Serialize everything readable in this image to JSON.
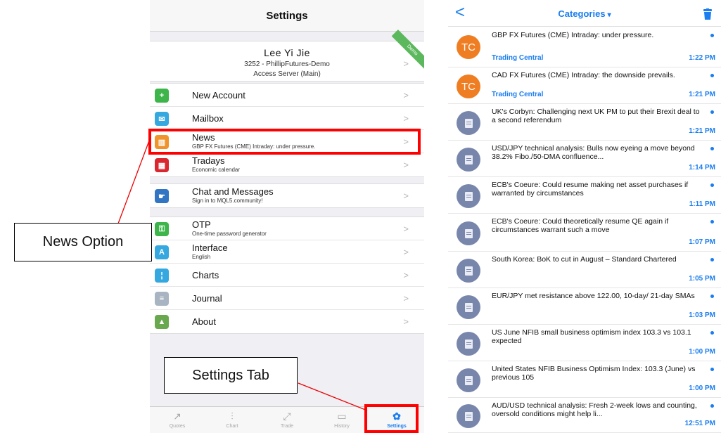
{
  "settings": {
    "header_title": "Settings",
    "account": {
      "name": "Lee Yi Jie",
      "line1": "3252 - PhillipFutures-Demo",
      "line2": "Access Server (Main)",
      "ribbon": "Demo"
    },
    "group1": [
      {
        "title": "New Account",
        "sub": "",
        "icon": "person-add-icon",
        "color": "#3db54a"
      },
      {
        "title": "Mailbox",
        "sub": "",
        "icon": "envelope-icon",
        "color": "#35a8e0"
      },
      {
        "title": "News",
        "sub": "GBP FX Futures (CME) Intraday: under pressure.",
        "icon": "book-icon",
        "color": "#f0932b"
      },
      {
        "title": "Tradays",
        "sub": "Economic calendar",
        "icon": "calendar-icon",
        "color": "#d9262f"
      }
    ],
    "group2": [
      {
        "title": "Chat and Messages",
        "sub": "Sign in to MQL5.community!",
        "icon": "chat-icon",
        "color": "#3275c2"
      }
    ],
    "group3": [
      {
        "title": "OTP",
        "sub": "One-time password generator",
        "icon": "key-icon",
        "color": "#3db54a"
      },
      {
        "title": "Interface",
        "sub": "English",
        "icon": "translate-icon",
        "color": "#35a8e0"
      },
      {
        "title": "Charts",
        "sub": "",
        "icon": "candles-icon",
        "color": "#35a8e0"
      },
      {
        "title": "Journal",
        "sub": "",
        "icon": "journal-icon",
        "color": "#a9b4c2"
      },
      {
        "title": "About",
        "sub": "",
        "icon": "about-icon",
        "color": "#6aa84f"
      }
    ],
    "tabs": [
      {
        "label": "Quotes",
        "icon": "quotes-icon",
        "glyph": "↗"
      },
      {
        "label": "Chart",
        "icon": "chart-icon",
        "glyph": "⫶"
      },
      {
        "label": "Trade",
        "icon": "trade-icon",
        "glyph": "⤢"
      },
      {
        "label": "History",
        "icon": "history-icon",
        "glyph": "▭"
      },
      {
        "label": "Settings",
        "icon": "gear-icon",
        "glyph": "✿"
      }
    ],
    "active_tab": "Settings"
  },
  "callouts": {
    "news_option": "News Option",
    "settings_tab": "Settings Tab"
  },
  "news": {
    "title": "Categories",
    "caret": "▾",
    "back": "<",
    "items": [
      {
        "headline": "GBP FX Futures (CME) Intraday: under pressure.",
        "source": "Trading Central",
        "time": "1:22 PM",
        "avatar": "TC"
      },
      {
        "headline": "CAD FX Futures (CME) Intraday: the downside prevails.",
        "source": "Trading Central",
        "time": "1:21 PM",
        "avatar": "TC"
      },
      {
        "headline": "UK's Corbyn: Challenging next UK PM to put their Brexit deal to a second referendum",
        "source": "",
        "time": "1:21 PM",
        "avatar": ""
      },
      {
        "headline": "USD/JPY technical analysis: Bulls now eyeing a move beyond 38.2% Fibo./50-DMA confluence...",
        "source": "",
        "time": "1:14 PM",
        "avatar": ""
      },
      {
        "headline": "ECB's Coeure: Could resume making net asset purchases if warranted by circumstances",
        "source": "",
        "time": "1:11 PM",
        "avatar": ""
      },
      {
        "headline": "ECB's Coeure: Could theoretically resume QE again if circumstances warrant such a move",
        "source": "",
        "time": "1:07 PM",
        "avatar": ""
      },
      {
        "headline": "South Korea: BoK to cut in August – Standard Chartered",
        "source": "",
        "time": "1:05 PM",
        "avatar": ""
      },
      {
        "headline": "EUR/JPY met resistance above 122.00, 10-day/ 21-day SMAs",
        "source": "",
        "time": "1:03 PM",
        "avatar": ""
      },
      {
        "headline": "US June NFIB small business optimism index 103.3 vs 103.1 expected",
        "source": "",
        "time": "1:00 PM",
        "avatar": ""
      },
      {
        "headline": "United States NFIB Business Optimism Index: 103.3 (June) vs previous 105",
        "source": "",
        "time": "1:00 PM",
        "avatar": ""
      },
      {
        "headline": "AUD/USD technical analysis: Fresh 2-week lows and counting, oversold conditions might help li...",
        "source": "",
        "time": "12:51 PM",
        "avatar": ""
      }
    ]
  }
}
